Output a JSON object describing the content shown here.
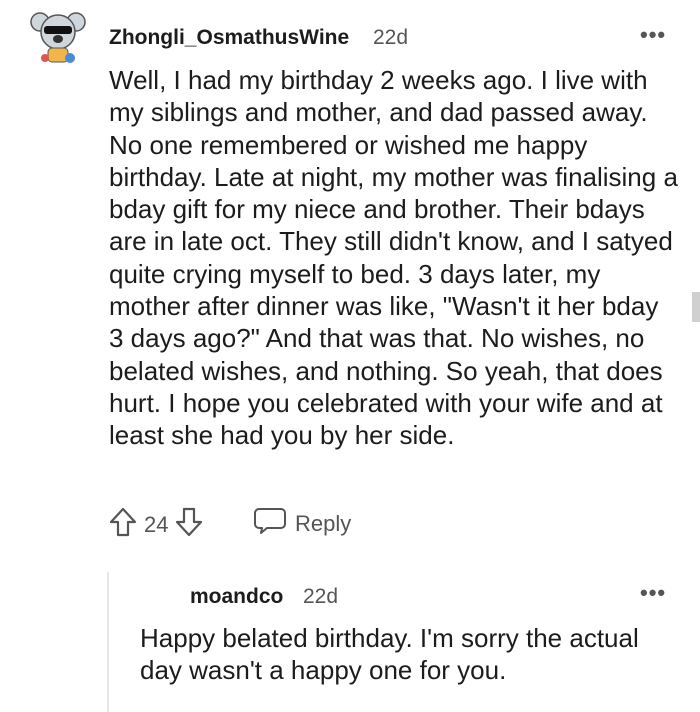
{
  "comment": {
    "username": "Zhongli_OsmathusWine",
    "age": "22d",
    "more_label": "•••",
    "body": "Well, I had my birthday 2 weeks ago. I live with my siblings and mother, and dad passed away. No one remembered or wished me happy birthday. Late at night, my mother was finalising a bday gift for my niece and brother. Their bdays are in late oct. They still didn't know, and I satyed quite crying myself to bed. 3 days later, my mother after dinner was like, \"Wasn't it her bday 3 days ago?\" And that was that. No wishes, no belated wishes, and nothing. So yeah, that does hurt. I hope you celebrated with your wife and at least she had you by her side.",
    "vote_count": "24",
    "reply_label": "Reply",
    "avatar_icon": "koala-avatar-icon"
  },
  "reply": {
    "username": "moandco",
    "age": "22d",
    "more_label": "•••",
    "body": "Happy belated birthday. I'm sorry the actual day wasn't a happy one for you."
  },
  "icons": {
    "upvote": "upvote-arrow-icon",
    "downvote": "downvote-arrow-icon",
    "reply": "speech-bubble-icon",
    "more": "more-options-icon"
  },
  "colors": {
    "text": "#1c1c1c",
    "meta": "#555555",
    "thread_line": "#e6e6e6"
  }
}
